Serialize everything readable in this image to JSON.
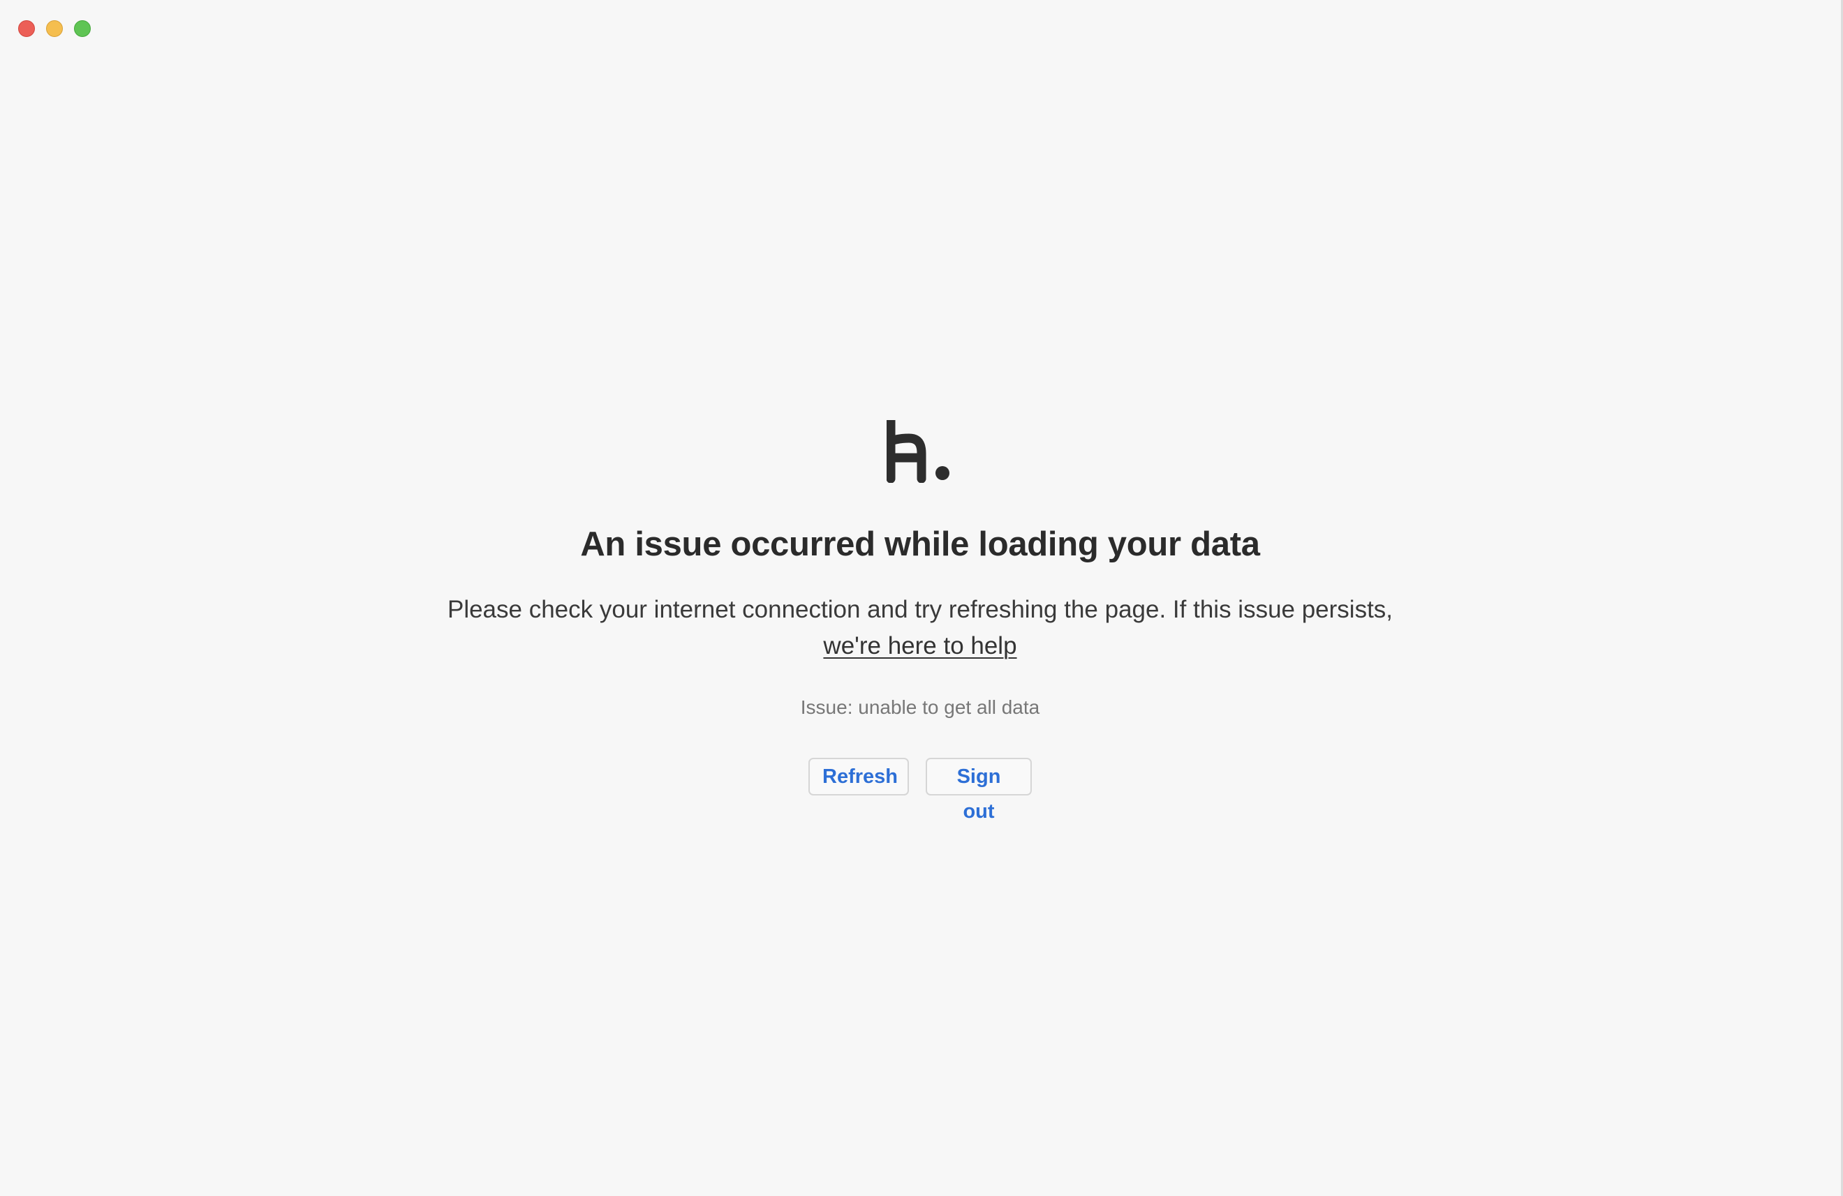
{
  "window": {
    "controls": [
      "close",
      "minimize",
      "zoom"
    ]
  },
  "logo": {
    "icon": "h-dot-logo-icon"
  },
  "error": {
    "heading": "An issue occurred while loading your data",
    "description": "Please check your internet connection and try refreshing the page. If this issue persists,",
    "help_link": "we're here to help",
    "issue_detail": "Issue: unable to get all data"
  },
  "actions": {
    "refresh_label": "Refresh",
    "signout_label": "Sign out"
  },
  "colors": {
    "background": "#f7f7f7",
    "heading": "#2b2b2b",
    "body_text": "#3a3a3a",
    "muted_text": "#777777",
    "button_text": "#2d6fd6",
    "close": "#ec5f57",
    "minimize": "#f5be4f",
    "zoom": "#5fc454"
  }
}
